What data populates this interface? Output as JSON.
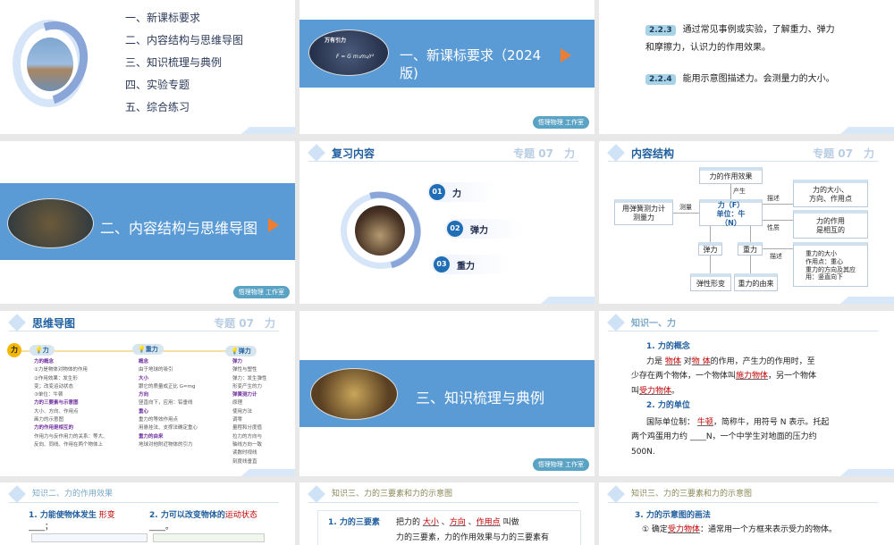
{
  "studio_badge": "悟理物理 工作室",
  "topic_label": "专题 07　力",
  "toc": {
    "items": [
      "一、新课标要求",
      "二、内容结构与思维导图",
      "三、知识梳理与典例",
      "四、实验专题",
      "五、综合练习"
    ]
  },
  "section1": {
    "title_line1": "一、新课标要求（2024",
    "title_line2": "版)",
    "image_caption": "万有引力",
    "formula": "F = G m₁m₂/r²"
  },
  "standards": {
    "items": [
      {
        "code": "2.2.3",
        "text": "通过常见事例或实验，了解重力、弹力",
        "text2": "和摩擦力，认识力的作用效果。"
      },
      {
        "code": "2.2.4",
        "text": "能用示意图描述力。会测量力的大小。"
      }
    ]
  },
  "section2": {
    "title": "二、内容结构与思维导图"
  },
  "review": {
    "title": "复习内容",
    "items": [
      {
        "num": "01",
        "label": "力"
      },
      {
        "num": "02",
        "label": "弹力"
      },
      {
        "num": "03",
        "label": "重力"
      }
    ]
  },
  "structure": {
    "title": "内容结构",
    "effect": "力的作用效果",
    "produce": "产生",
    "center": [
      "力（F）",
      "单位：牛",
      "（N）"
    ],
    "measure_label": "测量",
    "measure_box": [
      "用弹簧测力计",
      "测量力"
    ],
    "describe1": "描述",
    "r1": [
      "力的大小、",
      "方向、作用点"
    ],
    "nature": "性质",
    "r2": [
      "力的作用",
      "是相互的"
    ],
    "elastic": "弹力",
    "gravity": "重力",
    "describe2": "描述",
    "r3": [
      "重力的大小",
      "作用点：重心",
      "重力的方向及其应",
      "用：竖直向下"
    ],
    "elastic_def": "弹性形变",
    "gravity_origin": "重力的由来"
  },
  "mindmap": {
    "title": "思维导图",
    "root": "力",
    "col1": {
      "tag": "力",
      "h1": "力的概念",
      "a": "①力是物体对物体的作用",
      "b": "②作用效果：发生形",
      "b2": "变；改变运动状态",
      "c": "③单位：牛顿",
      "h2": "力的三要素与示意图",
      "d": "大小、方向、作用点",
      "e": "画力的示意图",
      "h3": "力的作用是相互的",
      "f": "作用力与反作用力的关系：等大、",
      "f2": "反向、同线、作用在两个物体上"
    },
    "col2": {
      "tag": "重力",
      "h1": "概念",
      "a": "由于地球的吸引",
      "h2": "大小",
      "b": "跟它的质量成正比 G=mg",
      "h3": "方向",
      "c": "竖直向下，应用：铅垂线",
      "h4": "重心",
      "d": "重力的等效作用点",
      "e": "用悬挂法、支撑法确定重心",
      "h5": "重力的由来",
      "f": "地球对他附近物体的引力"
    },
    "col3": {
      "tag": "弹力",
      "h1": "弹力",
      "a": "弹性与塑性",
      "b": "弹力：发生弹性",
      "b2": "形变产生的力",
      "h2": "弹簧测力计",
      "c": "原理",
      "d": "使用方法",
      "e": "调零",
      "f": "量程和分度值",
      "g": "拉力的方向与",
      "g2": "轴线方向一致",
      "h": "读数时视线",
      "h2b": "刻度线垂直"
    }
  },
  "section3": {
    "title": "三、知识梳理与典例"
  },
  "k1": {
    "title": "知识一、力",
    "s1": "1. 力的概念",
    "t1a": "力是",
    "f1": "物体",
    "t1b": "对",
    "f2": "物 体",
    "t1c": "的作用，产生力的作用时，至",
    "t2a": "少存在两个物体，一个物体叫",
    "f3": "施力物体",
    "t2b": "，另一个物体",
    "t3a": "叫",
    "f4": "受力物体",
    "t3b": "。",
    "s2": "2. 力的单位",
    "t4a": "国际单位制：",
    "f5": "牛顿",
    "t4b": "，简称牛，用符号 N 表示。托起",
    "t5": "两个鸡蛋用力约 ____N，一个中学生对地面的压力约",
    "t6": "500N."
  },
  "k2": {
    "title": "知识二、力的作用效果",
    "q1": "1. 力能使物体发生",
    "a1": "形变",
    "q1b": "____；",
    "q2": "2. 力可以改变物体的",
    "a2": "运动状态",
    "q2b": "____。"
  },
  "k3a": {
    "title": "知识三、力的三要素和力的示意图",
    "label": "1. 力的三要素",
    "t1": "把力的",
    "a1": "大小",
    "a2": "方向",
    "a3": "作用点",
    "t2": "叫做",
    "t3": "力的三要素，力的作用效果与力的三要素有"
  },
  "k3b": {
    "title": "知识三、力的三要素和力的示意图",
    "s": "3. 力的示意图的画法",
    "t1": "① 确定",
    "a1": "受力物体",
    "t2": "：通常用一个方框来表示受力的物体。"
  }
}
